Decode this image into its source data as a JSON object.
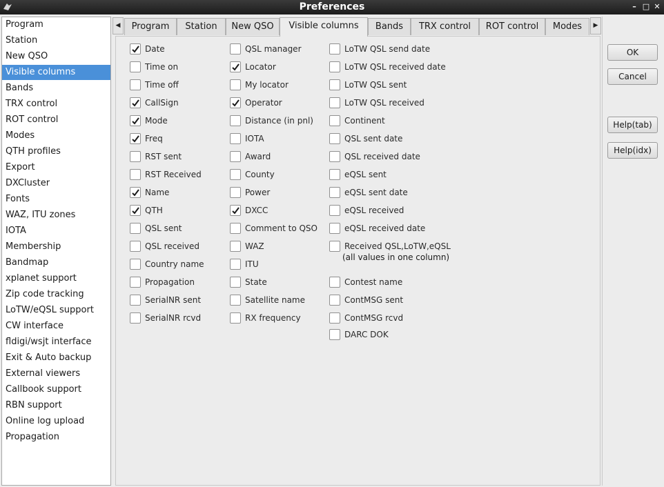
{
  "window": {
    "title": "Preferences"
  },
  "sidebar": {
    "selected": "Visible columns",
    "items": [
      "Program",
      "Station",
      "New QSO",
      "Visible columns",
      "Bands",
      "TRX control",
      "ROT control",
      "Modes",
      "QTH profiles",
      "Export",
      "DXCluster",
      "Fonts",
      "WAZ, ITU zones",
      "IOTA",
      "Membership",
      "Bandmap",
      "xplanet support",
      "Zip code tracking",
      "LoTW/eQSL support",
      "CW interface",
      "fldigi/wsjt interface",
      "Exit & Auto backup",
      "External viewers",
      "Callbook support",
      "RBN support",
      "Online log upload",
      "Propagation"
    ]
  },
  "tabs": {
    "active": "Visible columns",
    "items": [
      "Program",
      "Station",
      "New QSO",
      "Visible columns",
      "Bands",
      "TRX control",
      "ROT control",
      "Modes"
    ],
    "left_arrow_icon": "triangle-left-icon",
    "right_arrow_icon": "triangle-right-icon"
  },
  "columns": {
    "col1": [
      {
        "label": "Date",
        "checked": true
      },
      {
        "label": "Time on",
        "checked": false
      },
      {
        "label": "Time off",
        "checked": false
      },
      {
        "label": "CallSign",
        "checked": true
      },
      {
        "label": "Mode",
        "checked": true
      },
      {
        "label": "Freq",
        "checked": true
      },
      {
        "label": "RST sent",
        "checked": false
      },
      {
        "label": "RST Received",
        "checked": false
      },
      {
        "label": "Name",
        "checked": true
      },
      {
        "label": "QTH",
        "checked": true
      },
      {
        "label": "QSL sent",
        "checked": false
      },
      {
        "label": "QSL received",
        "checked": false
      },
      {
        "label": "Country name",
        "checked": false
      },
      {
        "label": "Propagation",
        "checked": false
      },
      {
        "label": "SerialNR sent",
        "checked": false
      },
      {
        "label": "SerialNR rcvd",
        "checked": false
      }
    ],
    "col2": [
      {
        "label": "QSL manager",
        "checked": false
      },
      {
        "label": "Locator",
        "checked": true
      },
      {
        "label": "My locator",
        "checked": false
      },
      {
        "label": "Operator",
        "checked": true
      },
      {
        "label": "Distance (in pnl)",
        "checked": false
      },
      {
        "label": "IOTA",
        "checked": false
      },
      {
        "label": "Award",
        "checked": false
      },
      {
        "label": "County",
        "checked": false
      },
      {
        "label": "Power",
        "checked": false
      },
      {
        "label": "DXCC",
        "checked": true
      },
      {
        "label": "Comment to QSO",
        "checked": false
      },
      {
        "label": "WAZ",
        "checked": false
      },
      {
        "label": "ITU",
        "checked": false
      },
      {
        "label": "State",
        "checked": false
      },
      {
        "label": "Satellite name",
        "checked": false
      },
      {
        "label": "RX frequency",
        "checked": false
      }
    ],
    "col3": [
      {
        "label": "LoTW QSL send date",
        "checked": false
      },
      {
        "label": "LoTW QSL received date",
        "checked": false
      },
      {
        "label": "LoTW QSL sent",
        "checked": false
      },
      {
        "label": "LoTW QSL received",
        "checked": false
      },
      {
        "label": "Continent",
        "checked": false
      },
      {
        "label": "QSL sent date",
        "checked": false
      },
      {
        "label": "QSL received date",
        "checked": false
      },
      {
        "label": "eQSL sent",
        "checked": false
      },
      {
        "label": "eQSL sent date",
        "checked": false
      },
      {
        "label": "eQSL received",
        "checked": false
      },
      {
        "label": "eQSL received date",
        "checked": false
      },
      {
        "label": "Received QSL,LoTW,eQSL",
        "checked": false
      },
      {
        "label": "Contest name",
        "checked": false
      },
      {
        "label": "ContMSG sent",
        "checked": false
      },
      {
        "label": "ContMSG rcvd",
        "checked": false
      },
      {
        "label": "DARC DOK",
        "checked": false
      }
    ],
    "received_note": "(all values in one column)"
  },
  "buttons": {
    "ok": "OK",
    "cancel": "Cancel",
    "help_tab": "Help(tab)",
    "help_idx": "Help(idx)"
  },
  "titlebar_icons": [
    "app-icon",
    "minimize-icon",
    "maximize-icon",
    "close-icon"
  ]
}
